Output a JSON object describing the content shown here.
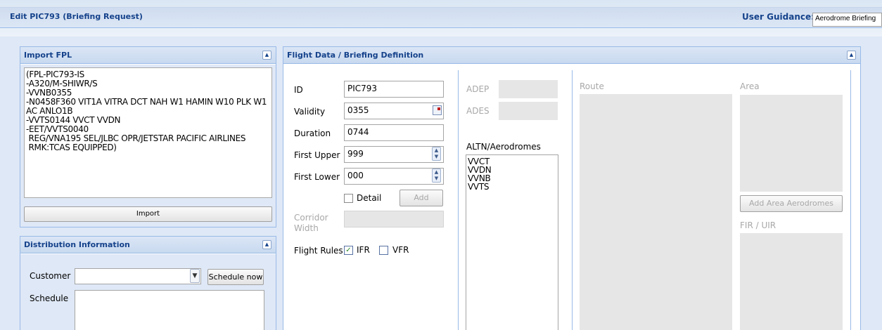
{
  "window": {
    "title": "Edit PIC793 (Briefing Request)"
  },
  "guidance": {
    "label": "User Guidance:",
    "value": "Aerodrome Briefing"
  },
  "import_fpl": {
    "title": "Import FPL",
    "text": "(FPL-PIC793-IS\n-A320/M-SHIWR/S\n-VVNB0355\n-N0458F360 VIT1A VITRA DCT NAH W1 HAMIN W10 PLK W1\nAC ANLO1B\n-VVTS0144 VVCT VVDN\n-EET/VVTS0040\n REG/VNA195 SEL/JLBC OPR/JETSTAR PACIFIC AIRLINES\n RMK:TCAS EQUIPPED)",
    "import_button": "Import"
  },
  "distribution": {
    "title": "Distribution Information",
    "customer_label": "Customer",
    "customer_value": "",
    "schedule_now_button": "Schedule now",
    "schedule_label": "Schedule",
    "schedule_value": ""
  },
  "flight_data": {
    "title": "Flight Data / Briefing Definition",
    "id_label": "ID",
    "id_value": "PIC793",
    "validity_label": "Validity",
    "validity_value": "0355",
    "duration_label": "Duration",
    "duration_value": "0744",
    "first_upper_label": "First Upper",
    "first_upper_value": "999",
    "first_lower_label": "First Lower",
    "first_lower_value": "000",
    "detail_label": "Detail",
    "detail_checked": false,
    "add_button": "Add",
    "corridor_width_label": "Corridor Width",
    "flight_rules_label": "Flight Rules",
    "ifr_label": "IFR",
    "ifr_checked": true,
    "vfr_label": "VFR",
    "vfr_checked": false,
    "adep_label": "ADEP",
    "ades_label": "ADES",
    "altn_label": "ALTN/Aerodromes",
    "altn_items": [
      "VVCT",
      "VVDN",
      "VVNB",
      "VVTS"
    ],
    "route_label": "Route",
    "area_label": "Area",
    "add_area_button": "Add Area Aerodromes",
    "fir_label": "FIR / UIR"
  }
}
